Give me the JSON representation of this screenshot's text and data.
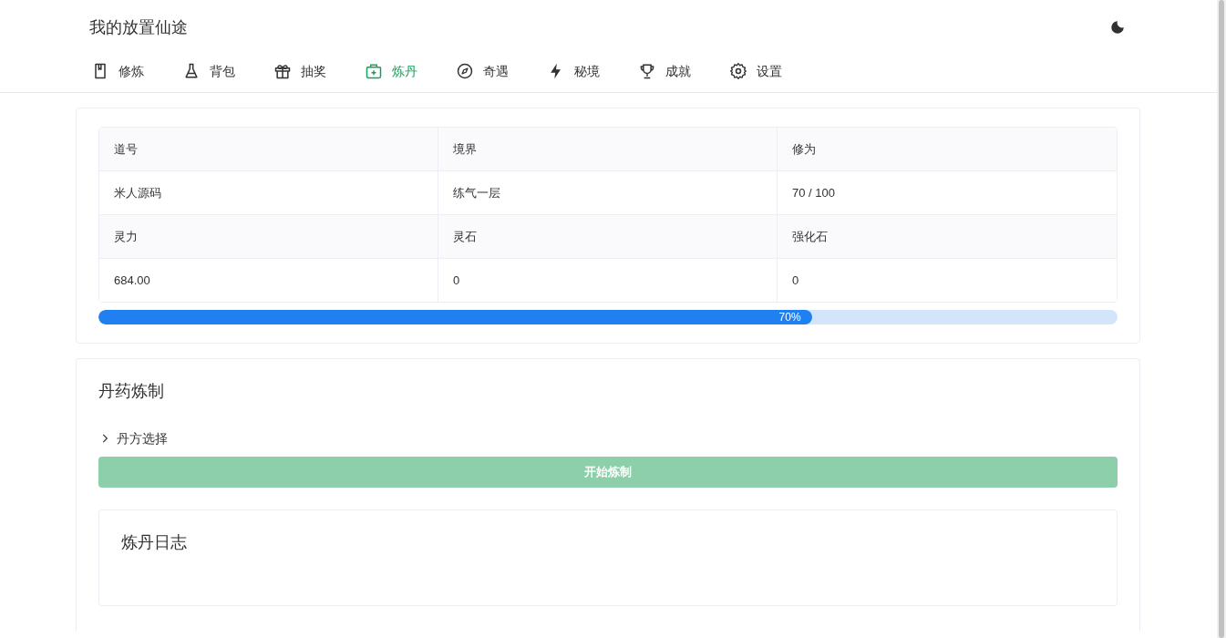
{
  "app_title": "我的放置仙途",
  "tabs": [
    {
      "label": "修炼",
      "selected": false
    },
    {
      "label": "背包",
      "selected": false
    },
    {
      "label": "抽奖",
      "selected": false
    },
    {
      "label": "炼丹",
      "selected": true
    },
    {
      "label": "奇遇",
      "selected": false
    },
    {
      "label": "秘境",
      "selected": false
    },
    {
      "label": "成就",
      "selected": false
    },
    {
      "label": "设置",
      "selected": false
    }
  ],
  "stats": [
    {
      "label": "道号",
      "value": "米人源码"
    },
    {
      "label": "境界",
      "value": "练气一层"
    },
    {
      "label": "修为",
      "value": "70 / 100"
    },
    {
      "label": "灵力",
      "value": "684.00"
    },
    {
      "label": "灵石",
      "value": "0"
    },
    {
      "label": "强化石",
      "value": "0"
    }
  ],
  "progress": {
    "level": 0.7,
    "reading": "70%"
  },
  "alchemy": {
    "title": "丹药炼制",
    "recipe_section": {
      "label": "丹方选择",
      "expanded": false
    },
    "start_button": {
      "label": "开始炼制",
      "disabled": true
    },
    "log": {
      "title": "炼丹日志"
    }
  }
}
